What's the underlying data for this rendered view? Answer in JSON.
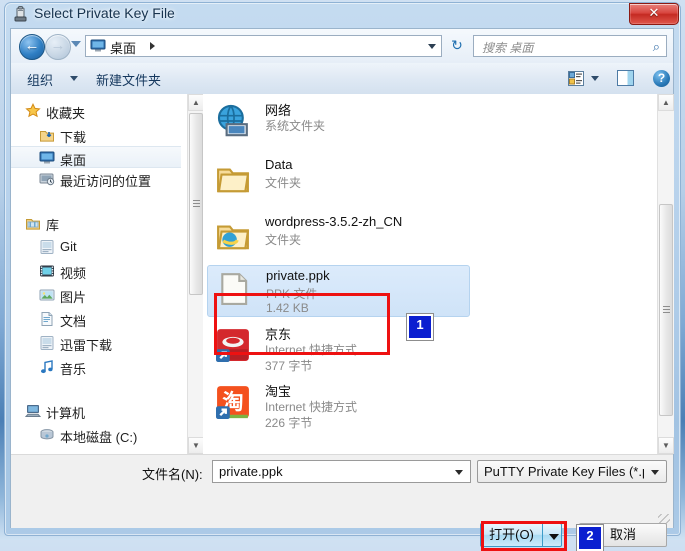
{
  "window": {
    "title": "Select Private Key File",
    "title_icon": "putty-icon",
    "close_label": "✕"
  },
  "nav": {
    "back_icon": "back-arrow-icon",
    "back_glyph": "←",
    "forward_icon": "forward-arrow-icon",
    "forward_glyph": "→",
    "recent_icon": "recent-pages-caret-icon",
    "address": {
      "icon": "desktop-icon",
      "path": "桌面",
      "separator": "▸",
      "dropdown_icon": "chevron-down-icon"
    },
    "refresh_icon": "refresh-icon",
    "refresh_glyph": "↻",
    "search": {
      "placeholder": "搜索 桌面",
      "icon": "search-icon",
      "glyph": "⌕"
    }
  },
  "toolbar": {
    "organize_label": "组织",
    "organize_caret_icon": "chevron-down-icon",
    "new_folder_label": "新建文件夹",
    "view_icon": "view-layout-icon",
    "view_caret_icon": "chevron-down-icon",
    "preview_pane_icon": "preview-pane-icon",
    "help_icon": "help-question-icon",
    "help_glyph": "?"
  },
  "sidebar": {
    "items": [
      {
        "label": "收藏夹",
        "icon": "star-icon",
        "level": "group",
        "selected": false
      },
      {
        "label": "下载",
        "icon": "downloads-icon",
        "level": "child",
        "selected": false
      },
      {
        "label": "桌面",
        "icon": "desktop-icon",
        "level": "child",
        "selected": true
      },
      {
        "label": "最近访问的位置",
        "icon": "recent-places-icon",
        "level": "child",
        "selected": false
      },
      {
        "label": "库",
        "icon": "library-icon",
        "level": "group",
        "selected": false
      },
      {
        "label": "Git",
        "icon": "library-item-icon",
        "level": "child",
        "selected": false
      },
      {
        "label": "视频",
        "icon": "videos-icon",
        "level": "child",
        "selected": false
      },
      {
        "label": "图片",
        "icon": "pictures-icon",
        "level": "child",
        "selected": false
      },
      {
        "label": "文档",
        "icon": "documents-icon",
        "level": "child",
        "selected": false
      },
      {
        "label": "迅雷下载",
        "icon": "library-item-icon",
        "level": "child",
        "selected": false
      },
      {
        "label": "音乐",
        "icon": "music-note-icon",
        "level": "child",
        "selected": false
      },
      {
        "label": "计算机",
        "icon": "computer-icon",
        "level": "group",
        "selected": false
      },
      {
        "label": "本地磁盘 (C:)",
        "icon": "hard-disk-icon",
        "level": "child",
        "selected": false
      }
    ]
  },
  "files": {
    "rows": [
      {
        "name": "网络",
        "type": "系统文件夹",
        "size": "",
        "icon": "network-globe-icon",
        "selected": false
      },
      {
        "name": "Data",
        "type": "文件夹",
        "size": "",
        "icon": "folder-icon",
        "selected": false
      },
      {
        "name": "wordpress-3.5.2-zh_CN",
        "type": "文件夹",
        "size": "",
        "icon": "folder-ie-icon",
        "selected": false
      },
      {
        "name": "private.ppk",
        "type": "PPK 文件",
        "size": "1.42 KB",
        "icon": "generic-file-icon",
        "selected": true
      },
      {
        "name": "京东",
        "type": "Internet 快捷方式",
        "size": "377 字节",
        "icon": "jd-shortcut-icon",
        "selected": false
      },
      {
        "name": "淘宝",
        "type": "Internet 快捷方式",
        "size": "226 字节",
        "icon": "taobao-shortcut-icon",
        "selected": false
      }
    ]
  },
  "scrollbars": {
    "up_glyph": "▲",
    "down_glyph": "▼"
  },
  "bottom": {
    "filename_label": "文件名(N):",
    "filename_value": "private.ppk",
    "filename_caret_icon": "chevron-down-icon",
    "filter_value": "PuTTY Private Key Files (*.pp",
    "filter_caret_icon": "chevron-down-icon",
    "open_label": "打开(O)",
    "open_split_icon": "chevron-down-icon",
    "cancel_label": "取消"
  },
  "annotations": {
    "badge_1": "1",
    "badge_2": "2",
    "highlight_color": "#ee1111",
    "badge_color": "#0b1fd0"
  }
}
